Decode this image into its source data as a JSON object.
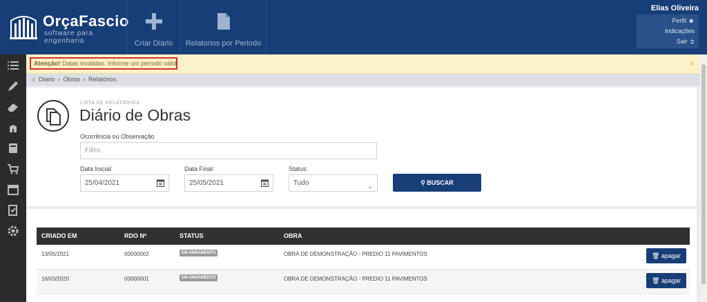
{
  "brand": {
    "title": "OrçaFascio",
    "subtitle": "software para engenharia"
  },
  "topnav": [
    {
      "label": "Criar Diario",
      "icon": "plus-icon"
    },
    {
      "label": "Relatorios por Periodo",
      "icon": "document-icon"
    }
  ],
  "user": {
    "name": "Elias Oliveira",
    "links": [
      "Perfil",
      "Indicações",
      "Sair"
    ]
  },
  "sidebar_icons": [
    "list-icon",
    "pencil-icon",
    "eraser-icon",
    "building-icon",
    "book-icon",
    "cart-icon",
    "calendar-icon",
    "checklist-icon",
    "gear-icon"
  ],
  "alert": {
    "strong": "Atenção!",
    "message": "Datas inválidas. Informe um período válido",
    "close": "×"
  },
  "breadcrumb": [
    "Diario",
    "Obras",
    "Relatórios"
  ],
  "panel": {
    "subtitle": "LISTA DE RELATÓRIOS",
    "title": "Diário de Obras",
    "filter_label": "Ocorrência ou Observação",
    "filter_placeholder": "Filtro",
    "start_label": "Data Inicial:",
    "start_value": "25/04/2021",
    "end_label": "Data Final:",
    "end_value": "25/05/2021",
    "status_label": "Status:",
    "status_value": "Tudo",
    "search_button": "BUSCAR"
  },
  "table": {
    "headers": [
      "CRIADO EM",
      "RDO Nº",
      "STATUS",
      "OBRA"
    ],
    "rows": [
      {
        "created": "13/05/2021",
        "rdo": "00000002",
        "status": "EM ANDAMENTO",
        "obra": "OBRA DE DEMONSTRAÇÃO - PREDIO 11 PAVIMENTOS",
        "action": "apagar"
      },
      {
        "created": "16/03/2020",
        "rdo": "00000001",
        "status": "EM ANDAMENTO",
        "obra": "OBRA DE DEMONSTRAÇÃO - PREDIO 11 PAVIMENTOS",
        "action": "apagar"
      }
    ]
  },
  "colors": {
    "navy": "#183e78",
    "sidebar": "#2b2b2b",
    "alert_bg": "#fcf1c7",
    "alert_border": "#d2312b",
    "badge": "#9a9a9a"
  }
}
